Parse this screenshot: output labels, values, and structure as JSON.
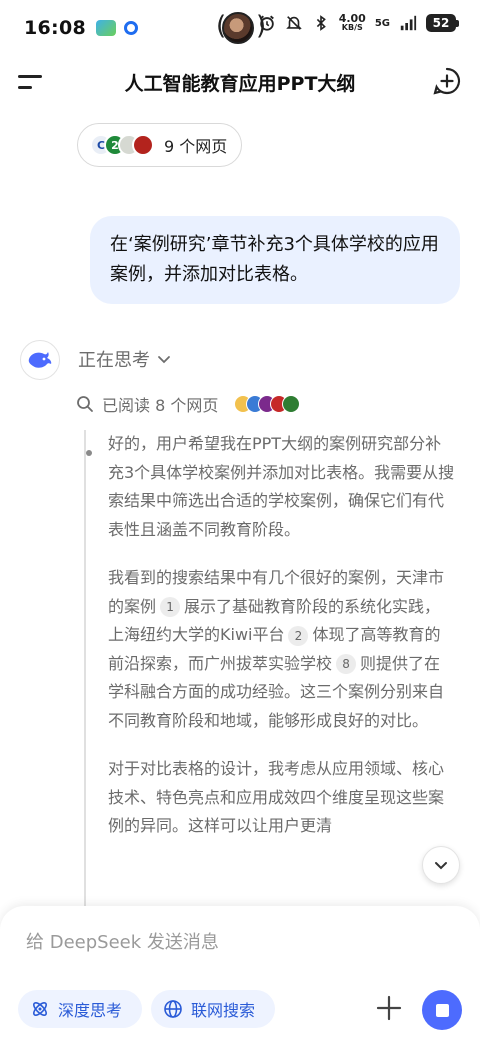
{
  "status_bar": {
    "time": "16:08",
    "net_speed_value": "4.00",
    "net_speed_unit": "KB/S",
    "network": "5G",
    "battery": "52"
  },
  "header": {
    "title": "人工智能教育应用PPT大纲"
  },
  "sources_chip": {
    "label": "9 个网页"
  },
  "user_message": "在‘案例研究’章节补充3个具体学校的应用案例，并添加对比表格。",
  "assistant": {
    "thinking_label": "正在思考",
    "read_label": "已阅读 8 个网页",
    "paragraphs": {
      "p1": "好的，用户希望我在PPT大纲的案例研究部分补充3个具体学校案例并添加对比表格。我需要从搜索结果中筛选出合适的学校案例，确保它们有代表性且涵盖不同教育阶段。",
      "p2_a": "我看到的搜索结果中有几个很好的案例，天津市的案例",
      "p2_cite1": "1",
      "p2_b": "展示了基础教育阶段的系统化实践，上海纽约大学的Kiwi平台",
      "p2_cite2": "2",
      "p2_c": "体现了高等教育的前沿探索，而广州拔萃实验学校",
      "p2_cite3": "8",
      "p2_d": "则提供了在学科融合方面的成功经验。这三个案例分别来自不同教育阶段和地域，能够形成良好的对比。",
      "p3": "对于对比表格的设计，我考虑从应用领域、核心技术、特色亮点和应用成效四个维度呈现这些案例的异同。这样可以让用户更清"
    }
  },
  "composer": {
    "placeholder": "给 DeepSeek 发送消息",
    "deep_think_label": "深度思考",
    "web_search_label": "联网搜索"
  },
  "colors": {
    "accent": "#4d6bfe",
    "user_bubble": "#eaf1ff",
    "mode_button_bg": "#eef3ff",
    "mode_button_text": "#2a5bd7"
  }
}
